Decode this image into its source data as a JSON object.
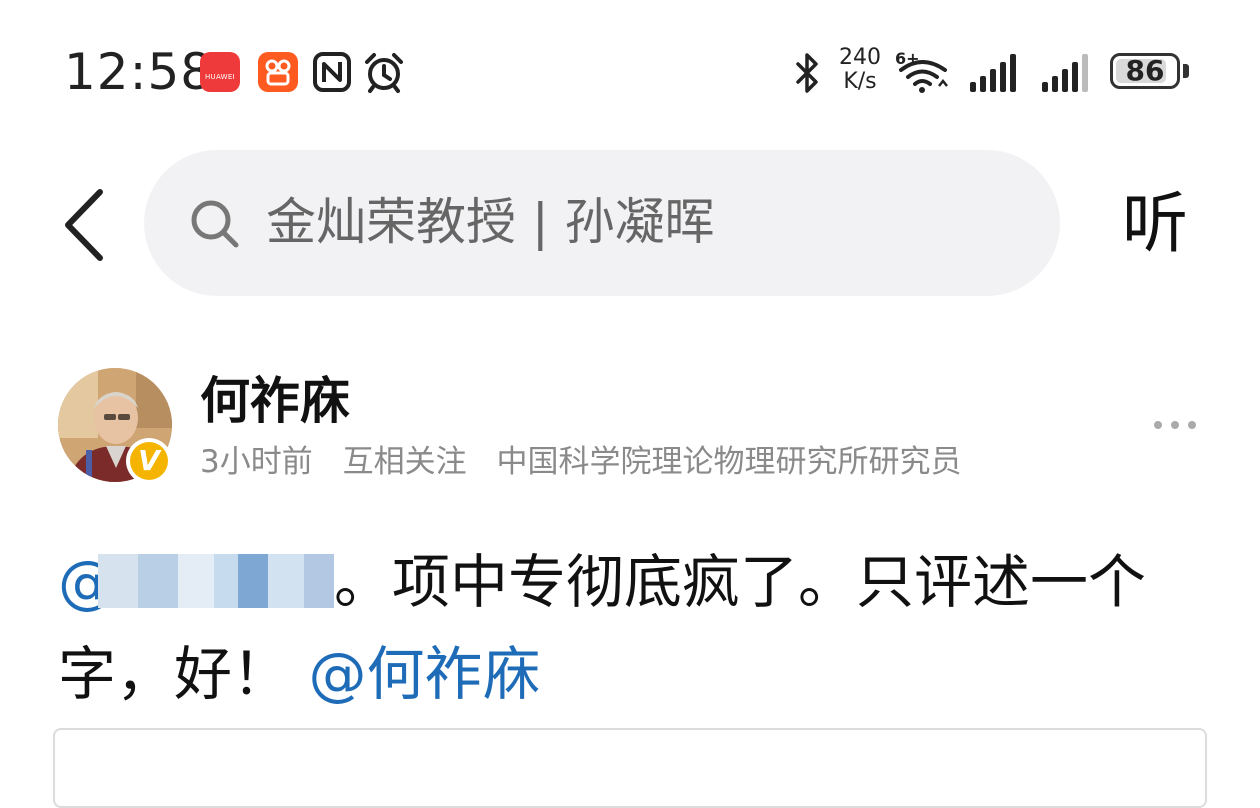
{
  "status_bar": {
    "time": "12:58",
    "apps": [
      "huawei-appgallery-icon",
      "kuaishou-icon",
      "nfc-icon",
      "alarm-icon"
    ],
    "huawei_label": "HUAWEI",
    "net_speed_value": "240",
    "net_speed_unit": "K/s",
    "wifi_label": "6+",
    "battery_level": "86",
    "battery_fraction": 0.86
  },
  "search": {
    "query": "金灿荣教授 | 孙凝晖",
    "listen_label": "听"
  },
  "post": {
    "author": "何祚庥",
    "time_ago": "3小时前",
    "relation": "互相关注",
    "title": "中国科学院理论物理研究所研究员",
    "body_text": "。项中专彻底疯了。只评述一个字，好！",
    "mention_at": "@",
    "mention_self": "@何祚庥"
  },
  "colors": {
    "mention": "#1e6bb8",
    "badge": "#f5b400",
    "search_bg": "#f2f2f4",
    "meta_text": "#8a8a8a"
  }
}
